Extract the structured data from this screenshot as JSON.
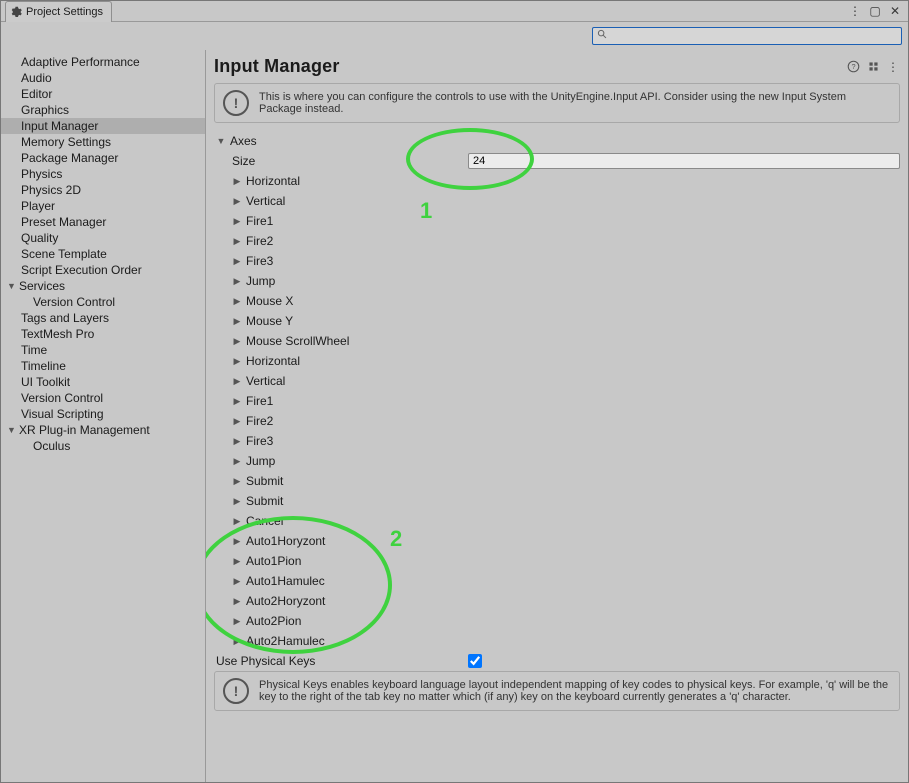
{
  "window": {
    "tab_title": "Project Settings"
  },
  "search": {
    "value": "",
    "placeholder": ""
  },
  "sidebar": {
    "items": [
      {
        "label": "Adaptive Performance",
        "type": "item"
      },
      {
        "label": "Audio",
        "type": "item"
      },
      {
        "label": "Editor",
        "type": "item"
      },
      {
        "label": "Graphics",
        "type": "item"
      },
      {
        "label": "Input Manager",
        "type": "item",
        "selected": true
      },
      {
        "label": "Memory Settings",
        "type": "item"
      },
      {
        "label": "Package Manager",
        "type": "item"
      },
      {
        "label": "Physics",
        "type": "item"
      },
      {
        "label": "Physics 2D",
        "type": "item"
      },
      {
        "label": "Player",
        "type": "item"
      },
      {
        "label": "Preset Manager",
        "type": "item"
      },
      {
        "label": "Quality",
        "type": "item"
      },
      {
        "label": "Scene Template",
        "type": "item"
      },
      {
        "label": "Script Execution Order",
        "type": "item"
      },
      {
        "label": "Services",
        "type": "group",
        "expanded": true,
        "children": [
          {
            "label": "Version Control"
          }
        ]
      },
      {
        "label": "Tags and Layers",
        "type": "item"
      },
      {
        "label": "TextMesh Pro",
        "type": "item"
      },
      {
        "label": "Time",
        "type": "item"
      },
      {
        "label": "Timeline",
        "type": "item"
      },
      {
        "label": "UI Toolkit",
        "type": "item"
      },
      {
        "label": "Version Control",
        "type": "item"
      },
      {
        "label": "Visual Scripting",
        "type": "item"
      },
      {
        "label": "XR Plug-in Management",
        "type": "group",
        "expanded": true,
        "children": [
          {
            "label": "Oculus"
          }
        ]
      }
    ]
  },
  "main": {
    "heading": "Input Manager",
    "info1": "This is where you can configure the controls to use with the UnityEngine.Input API. Consider using the new Input System Package instead.",
    "axes_label": "Axes",
    "size_label": "Size",
    "size_value": "24",
    "axes": [
      "Horizontal",
      "Vertical",
      "Fire1",
      "Fire2",
      "Fire3",
      "Jump",
      "Mouse X",
      "Mouse Y",
      "Mouse ScrollWheel",
      "Horizontal",
      "Vertical",
      "Fire1",
      "Fire2",
      "Fire3",
      "Jump",
      "Submit",
      "Submit",
      "Cancel",
      "Auto1Horyzont",
      "Auto1Pion",
      "Auto1Hamulec",
      "Auto2Horyzont",
      "Auto2Pion",
      "Auto2Hamulec"
    ],
    "physical_keys_label": "Use Physical Keys",
    "physical_keys_checked": true,
    "info2": "Physical Keys enables keyboard language layout independent mapping of key codes to physical keys. For example, 'q' will be the key to the right of the tab key no matter which (if any) key on the keyboard currently generates a 'q' character."
  },
  "annotations": {
    "n1": "1",
    "n2": "2"
  }
}
